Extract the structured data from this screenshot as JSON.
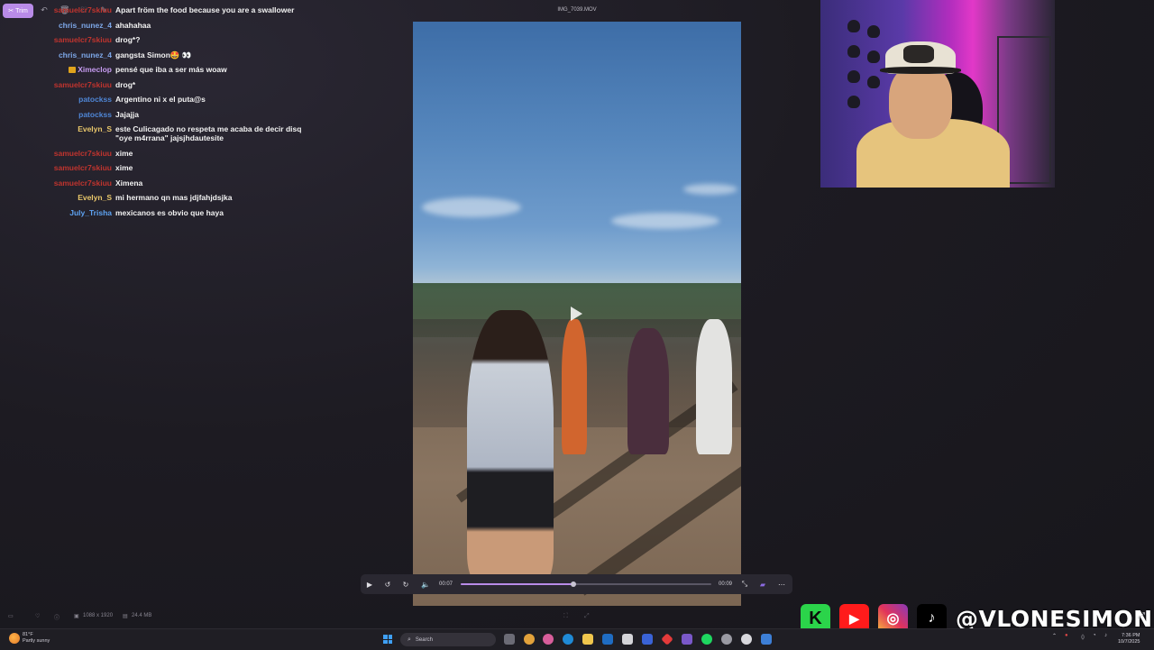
{
  "toolbar": {
    "trim_label": "Trim"
  },
  "chat": {
    "messages": [
      {
        "user": "samuelcr7skiuu",
        "text": "Apart fröm the food because you are a swallower"
      },
      {
        "user": "chris_nunez_4",
        "text": "ahahahaa"
      },
      {
        "user": "samuelcr7skiuu",
        "text": "drog*?"
      },
      {
        "user": "chris_nunez_4",
        "text": "gangsta Simon🤩 👀"
      },
      {
        "user": "Ximeclop",
        "text": "pensé que iba a ser más woaw"
      },
      {
        "user": "samuelcr7skiuu",
        "text": "drog*"
      },
      {
        "user": "patockss",
        "text": "Argentino ni x el puta@s"
      },
      {
        "user": "patockss",
        "text": "Jajajja"
      },
      {
        "user": "Evelyn_S",
        "text": "este Culicagado no respeta me acaba de decir disq \"oye m4rrana\" jajsjhdautesite"
      },
      {
        "user": "samuelcr7skiuu",
        "text": "xime"
      },
      {
        "user": "samuelcr7skiuu",
        "text": "xime"
      },
      {
        "user": "samuelcr7skiuu",
        "text": "Ximena"
      },
      {
        "user": "Evelyn_S",
        "text": "mi hermano qn mas jdjfahjdsjka"
      },
      {
        "user": "July_Trisha",
        "text": "mexicanos es obvio que haya"
      }
    ]
  },
  "video": {
    "filename": "IMG_7039.MOV",
    "current_time": "00:07",
    "duration": "00:09",
    "progress": 0.45
  },
  "file_info": {
    "dimensions": "1088 x 1920",
    "size": "24.4 MB"
  },
  "socials": {
    "handle": "@VLONESIMON"
  },
  "taskbar": {
    "temperature": "81°F",
    "weather": "Partly sunny",
    "search_placeholder": "Search",
    "time": "7:36 PM",
    "date": "10/7/2025"
  },
  "colors": {
    "accent": "#b98be8",
    "user_red": "#c0342e",
    "user_blue": "#7da7e8",
    "user_yellow": "#e8c66a",
    "user_purple": "#c69bf0"
  }
}
